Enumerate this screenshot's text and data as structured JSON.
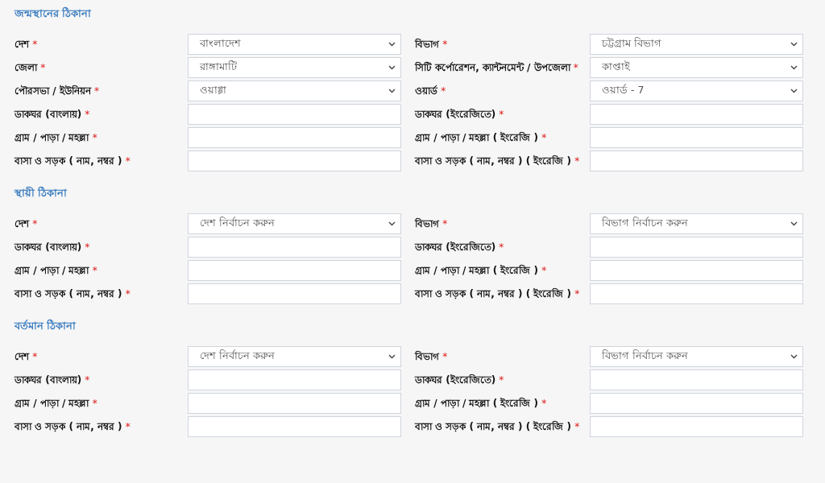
{
  "sections": [
    {
      "title": "জন্মস্থানের ঠিকানা",
      "rows": [
        {
          "left": {
            "label": "দেশ",
            "mark": "*",
            "kind": "select",
            "value": "বাংলাদেশ"
          },
          "right": {
            "label": "বিভাগ",
            "mark": "*",
            "kind": "select",
            "value": "চট্টগ্রাম বিভাগ"
          }
        },
        {
          "left": {
            "label": "জেলা",
            "mark": "*",
            "kind": "select",
            "value": "রাঙ্গামাটি"
          },
          "right": {
            "label": "সিটি কর্পোরেশন, ক্যান্টনমেন্ট / উপজেলা",
            "mark": "*",
            "kind": "select",
            "value": "কাপ্তাই"
          }
        },
        {
          "left": {
            "label": "পৌরসভা / ইউনিয়ন",
            "mark": "*",
            "kind": "select",
            "value": "ওয়াগ্গা"
          },
          "right": {
            "label": "ওয়ার্ড",
            "mark": "*",
            "kind": "select",
            "value": "ওয়ার্ড - 7"
          }
        },
        {
          "left": {
            "label": "ডাকঘর (বাংলায়)",
            "mark": "*",
            "kind": "text"
          },
          "right": {
            "label": "ডাকঘর (ইংরেজিতে)",
            "mark": "*",
            "kind": "text"
          }
        },
        {
          "left": {
            "label": "গ্রাম / পাড়া / মহল্লা",
            "mark": "*",
            "kind": "text"
          },
          "right": {
            "label": "গ্রাম / পাড়া / মহল্লা ( ইংরেজি )",
            "mark": "*",
            "kind": "text"
          }
        },
        {
          "left": {
            "label": "বাসা ও সড়ক ( নাম, নম্বর )",
            "mark": "*",
            "kind": "text"
          },
          "right": {
            "label": "বাসা ও সড়ক ( নাম, নম্বর ) ( ইংরেজি )",
            "mark": "*",
            "kind": "text"
          }
        }
      ]
    },
    {
      "title": "স্থায়ী ঠিকানা",
      "rows": [
        {
          "left": {
            "label": "দেশ",
            "mark": "*",
            "kind": "select",
            "value": "দেশ নির্বাচন করুন"
          },
          "right": {
            "label": "বিভাগ",
            "mark": "*",
            "kind": "select",
            "value": "বিভাগ নির্বাচন করুন"
          }
        },
        {
          "left": {
            "label": "ডাকঘর (বাংলায়)",
            "mark": "*",
            "kind": "text"
          },
          "right": {
            "label": "ডাকঘর (ইংরেজিতে)",
            "mark": "*",
            "kind": "text"
          }
        },
        {
          "left": {
            "label": "গ্রাম / পাড়া / মহল্লা",
            "mark": "*",
            "kind": "text"
          },
          "right": {
            "label": "গ্রাম / পাড়া / মহল্লা ( ইংরেজি )",
            "mark": "*",
            "kind": "text"
          }
        },
        {
          "left": {
            "label": "বাসা ও সড়ক ( নাম, নম্বর )",
            "mark": "*",
            "kind": "text"
          },
          "right": {
            "label": "বাসা ও সড়ক ( নাম, নম্বর ) ( ইংরেজি )",
            "mark": "*",
            "kind": "text"
          }
        }
      ]
    },
    {
      "title": "বর্তমান ঠিকানা",
      "rows": [
        {
          "left": {
            "label": "দেশ",
            "mark": "*",
            "kind": "select",
            "value": "দেশ নির্বাচন করুন"
          },
          "right": {
            "label": "বিভাগ",
            "mark": "*",
            "kind": "select",
            "value": "বিভাগ নির্বাচন করুন"
          }
        },
        {
          "left": {
            "label": "ডাকঘর (বাংলায়)",
            "mark": "*",
            "kind": "text"
          },
          "right": {
            "label": "ডাকঘর (ইংরেজিতে)",
            "mark": "*",
            "kind": "text"
          }
        },
        {
          "left": {
            "label": "গ্রাম / পাড়া / মহল্লা",
            "mark": "*",
            "kind": "text"
          },
          "right": {
            "label": "গ্রাম / পাড়া / মহল্লা ( ইংরেজি )",
            "mark": "*",
            "kind": "text"
          }
        },
        {
          "left": {
            "label": "বাসা ও সড়ক ( নাম, নম্বর )",
            "mark": "*",
            "kind": "text"
          },
          "right": {
            "label": "বাসা ও সড়ক ( নাম, নম্বর ) ( ইংরেজি )",
            "mark": "*",
            "kind": "text"
          }
        }
      ]
    }
  ]
}
